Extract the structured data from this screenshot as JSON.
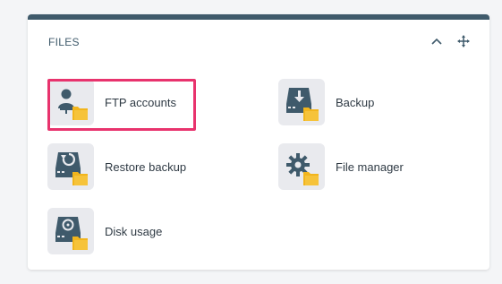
{
  "panel": {
    "title": "FILES",
    "items": [
      {
        "label": "FTP accounts",
        "icon": "ftp-user-folder-icon"
      },
      {
        "label": "Backup",
        "icon": "backup-drive-icon"
      },
      {
        "label": "Restore backup",
        "icon": "restore-backup-icon"
      },
      {
        "label": "File manager",
        "icon": "gear-folder-icon"
      },
      {
        "label": "Disk usage",
        "icon": "disk-usage-icon"
      }
    ]
  },
  "colors": {
    "accent_bar": "#3f5a6b",
    "icon_dark": "#3f5a6b",
    "folder": "#f2b51c",
    "highlight": "#e8336d"
  }
}
